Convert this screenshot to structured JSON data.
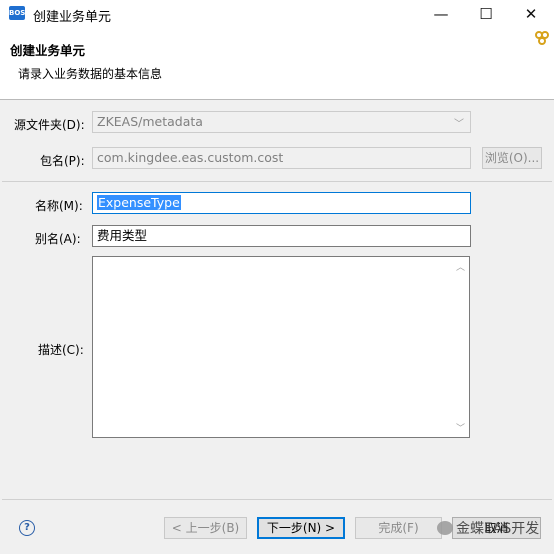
{
  "window": {
    "title": "创建业务单元",
    "app_icon_text": "BOS",
    "minimize_glyph": "—",
    "maximize_glyph": "☐",
    "close_glyph": "✕"
  },
  "banner": {
    "title": "创建业务单元",
    "description": "请录入业务数据的基本信息",
    "icon": "gear-cluster-icon"
  },
  "form": {
    "source_folder": {
      "label": "源文件夹(D):",
      "value": "ZKEAS/metadata"
    },
    "package": {
      "label": "包名(P):",
      "value": "com.kingdee.eas.custom.cost",
      "browse_label": "浏览(O)..."
    },
    "name": {
      "label": "名称(M):",
      "value": "ExpenseType"
    },
    "alias": {
      "label": "别名(A):",
      "value": "费用类型"
    },
    "description": {
      "label": "描述(C):",
      "value": ""
    }
  },
  "footer": {
    "help_glyph": "?",
    "back_label": "< 上一步(B)",
    "next_label": "下一步(N) >",
    "finish_label": "完成(F)",
    "cancel_label": "取消"
  },
  "watermark": {
    "text": "金蝶EAS开发"
  }
}
